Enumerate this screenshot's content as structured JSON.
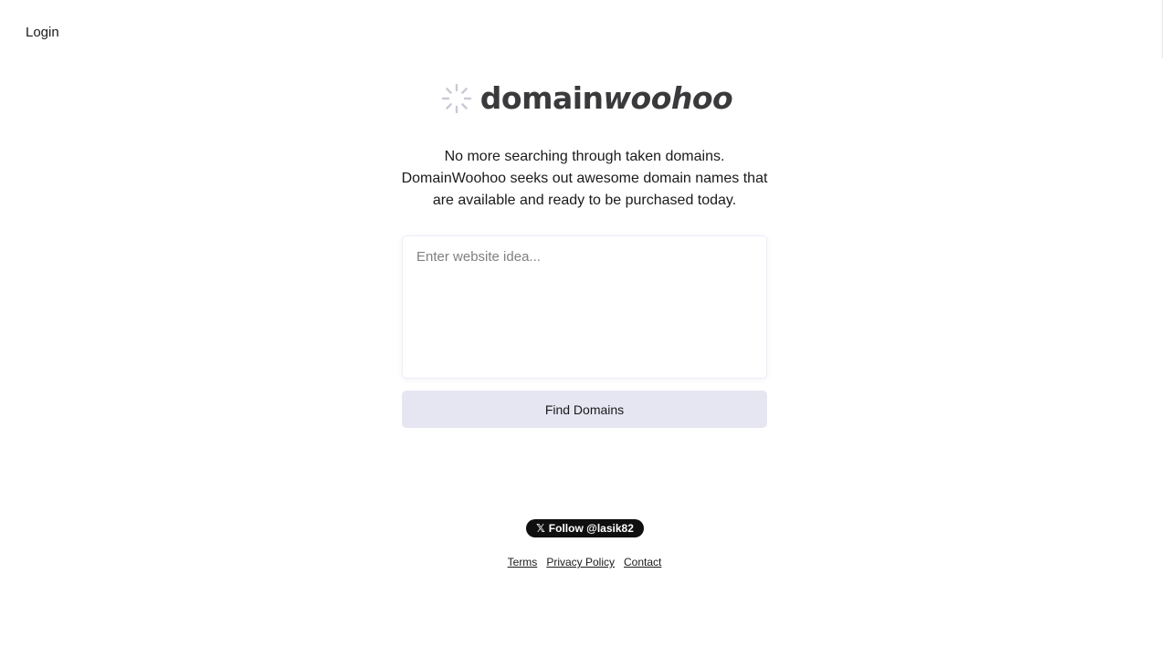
{
  "header": {
    "login_label": "Login"
  },
  "logo": {
    "text_regular": "domain",
    "text_italic": "woohoo",
    "icon": "spinner-icon",
    "icon_color": "#c9c9d6"
  },
  "tagline": "No more searching through taken domains. DomainWoohoo seeks out awesome domain names that are available and ready to be purchased today.",
  "search": {
    "placeholder": "Enter website idea...",
    "value": ""
  },
  "find_button_label": "Find Domains",
  "follow_button": {
    "icon": "x-logo-icon",
    "label": "Follow @lasik82"
  },
  "footer": {
    "links": [
      "Terms",
      "Privacy Policy",
      "Contact"
    ]
  },
  "colors": {
    "button_bg": "#e6e6f3",
    "text": "#1a1a1a",
    "logo_text": "#3a3a3c"
  }
}
